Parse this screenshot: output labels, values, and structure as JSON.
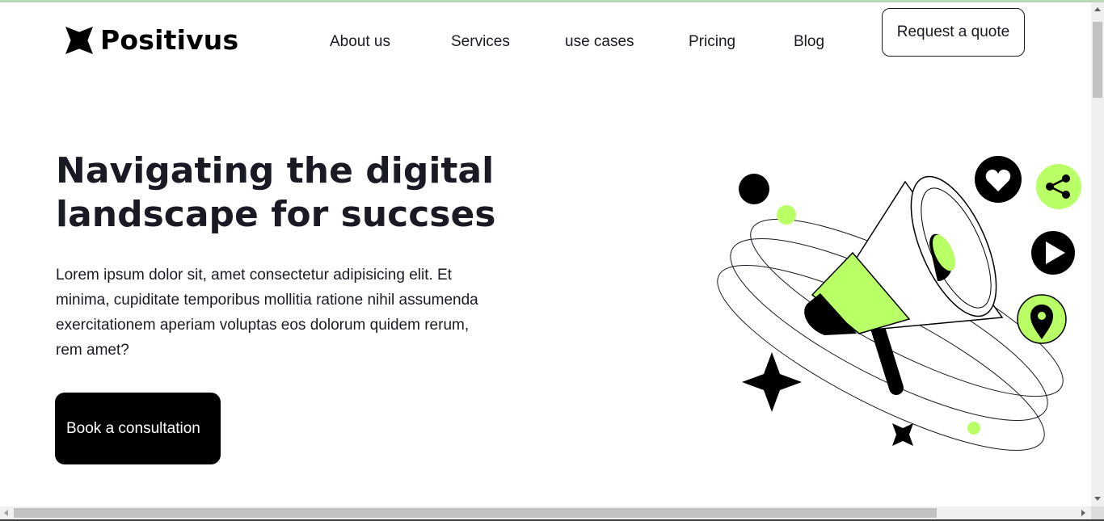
{
  "brand": {
    "name": "Positivus",
    "logo_icon": "star-burst-logo-icon"
  },
  "nav": {
    "items": [
      {
        "label": "About us"
      },
      {
        "label": "Services"
      },
      {
        "label": "use cases"
      },
      {
        "label": "Pricing"
      },
      {
        "label": "Blog"
      }
    ],
    "cta_label": "Request a quote"
  },
  "hero": {
    "title": "Navigating the digital landscape for succses",
    "description": "Lorem ipsum dolor sit, amet consectetur adipisicing elit. Et minima, cupiditate temporibus mollitia ratione nihil assumenda exercitationem aperiam voluptas eos dolorum quidem rerum, rem amet?",
    "button_label": "Book a consultation"
  },
  "illustration": {
    "icons": [
      "megaphone-icon",
      "heart-icon",
      "share-icon",
      "play-icon",
      "location-pin-icon",
      "sparkle-star-icon"
    ]
  },
  "colors": {
    "accent": "#b9ff66",
    "dark": "#191a23",
    "black": "#000000",
    "white": "#ffffff"
  }
}
